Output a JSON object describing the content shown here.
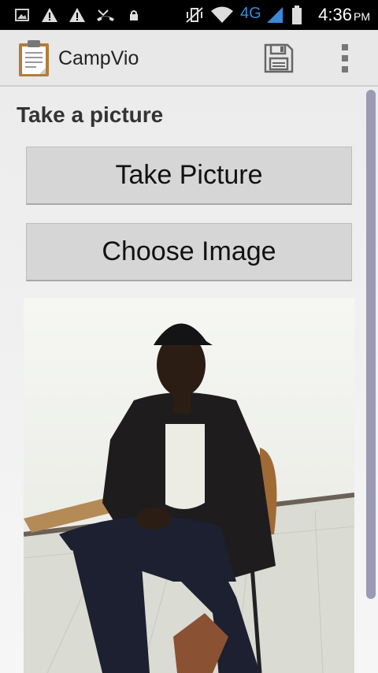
{
  "status_bar": {
    "time": "4:36",
    "ampm": "PM",
    "network": "4G",
    "icons": [
      "gallery-notification-icon",
      "warning-icon",
      "warning-icon",
      "missed-call-icon",
      "lock-icon",
      "vibrate-off-icon",
      "wifi-icon",
      "signal-icon",
      "battery-icon"
    ]
  },
  "action_bar": {
    "title": "CampVio",
    "icons": [
      "clipboard-app-icon",
      "save-icon",
      "overflow-menu-icon"
    ]
  },
  "main": {
    "section_title": "Take a picture",
    "take_picture_label": "Take Picture",
    "choose_image_label": "Choose Image",
    "photo_description": "photo-preview"
  },
  "colors": {
    "status_bar": "#000000",
    "action_bar": "#e8e8e8",
    "button": "#d6d6d6",
    "network_4g": "#3a8ad8",
    "scrollbar": "#9a9ab5"
  }
}
